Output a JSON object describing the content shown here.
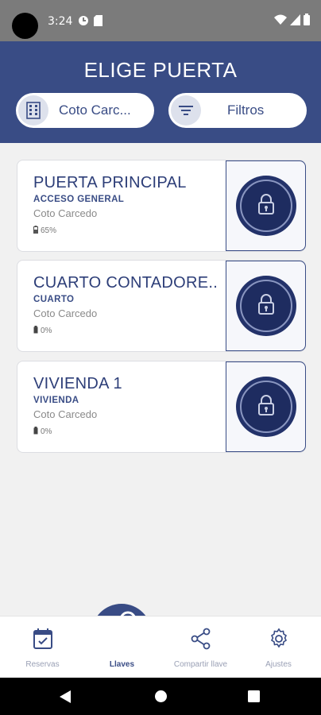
{
  "status_bar": {
    "time": "3:24",
    "icons": [
      "camera-cutout-icon",
      "data-saver-icon",
      "sd-card-icon",
      "wifi-icon",
      "signal-icon",
      "battery-icon"
    ]
  },
  "header": {
    "title": "ELIGE PUERTA",
    "location_selector": {
      "value": "Coto Carc...",
      "icon": "building-icon"
    },
    "filter_button": {
      "label": "Filtros",
      "icon": "filter-icon"
    }
  },
  "doors": [
    {
      "name": "PUERTA PRINCIPAL",
      "type": "ACCESO GENERAL",
      "location": "Coto Carcedo",
      "battery": "65%",
      "lock_icon": "padlock-icon"
    },
    {
      "name": "CUARTO CONTADORE..",
      "type": "CUARTO",
      "location": "Coto Carcedo",
      "battery": "0%",
      "lock_icon": "padlock-icon"
    },
    {
      "name": "VIVIENDA 1",
      "type": "VIVIENDA",
      "location": "Coto Carcedo",
      "battery": "0%",
      "lock_icon": "padlock-icon"
    }
  ],
  "bottom_nav": {
    "items": [
      {
        "label": "Reservas",
        "icon": "calendar-icon"
      },
      {
        "label": "Llaves",
        "icon": "key-icon",
        "active": true
      },
      {
        "label": "Compartir llave",
        "icon": "share-icon"
      },
      {
        "label": "Ajustes",
        "icon": "gear-icon"
      }
    ]
  },
  "colors": {
    "primary": "#394c85",
    "primary_dark": "#23326a",
    "background": "#f1f1f1"
  }
}
